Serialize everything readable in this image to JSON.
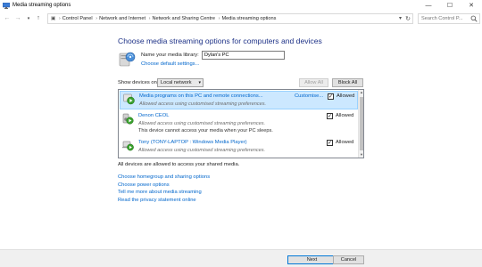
{
  "window": {
    "title": "Media streaming options",
    "minimize": "—",
    "maximize": "☐",
    "close": "✕"
  },
  "address_bar": {
    "breadcrumbs": [
      "Control Panel",
      "Network and Internet",
      "Network and Sharing Centre",
      "Media streaming options"
    ],
    "search_placeholder": "Search Control P..."
  },
  "main": {
    "heading": "Choose media streaming options for computers and devices",
    "library_label": "Name your media library:",
    "library_value": "Dylan's PC",
    "default_settings_link": "Choose default settings...",
    "show_devices_label": "Show devices on:",
    "show_devices_value": "Local network",
    "allow_all": "Allow All",
    "block_all": "Block All"
  },
  "devices": [
    {
      "name": "Media programs on this PC and remote connections...",
      "line1": "Allowed access using customised streaming preferences.",
      "line2": "",
      "customise": "Customise...",
      "allowed_label": "Allowed",
      "allowed": true,
      "selected": true
    },
    {
      "name": "Denon CEOL",
      "line1": "Allowed access using customised streaming preferences.",
      "line2": "This device cannot access your media when your PC sleeps.",
      "customise": "",
      "allowed_label": "Allowed",
      "allowed": true,
      "selected": false
    },
    {
      "name": "Tony (TONY-LAPTOP : Windows Media Player)",
      "line1": "Allowed access using customised streaming preferences.",
      "line2": "",
      "customise": "",
      "allowed_label": "Allowed",
      "allowed": true,
      "selected": false
    }
  ],
  "status": "All devices are allowed to access your shared media.",
  "links": [
    "Choose homegroup and sharing options",
    "Choose power options",
    "Tell me more about media streaming",
    "Read the privacy statement online"
  ],
  "footer": {
    "next": "Next",
    "cancel": "Cancel"
  },
  "colors": {
    "heading": "#1e3287",
    "link": "#0066cc",
    "selection": "#cce8ff",
    "footer_bg": "#f0f0f0"
  }
}
